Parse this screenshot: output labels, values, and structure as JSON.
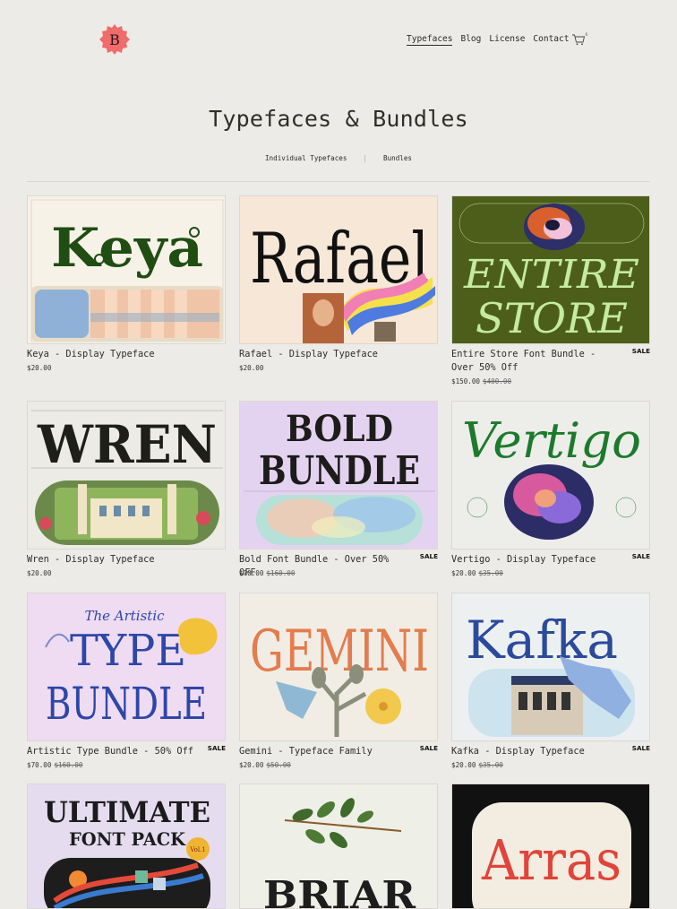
{
  "header": {
    "logo_letter": "B",
    "nav": [
      {
        "label": "Typefaces",
        "active": true
      },
      {
        "label": "Blog"
      },
      {
        "label": "License"
      },
      {
        "label": "Contact"
      }
    ],
    "cart_count": "0"
  },
  "page": {
    "title": "Typefaces & Bundles",
    "filters": [
      "Individual Typefaces",
      "Bundles"
    ]
  },
  "products": [
    {
      "title": "Keya - Display Typeface",
      "price": "$20.00",
      "old_price": "",
      "sale": "",
      "art": "Keya"
    },
    {
      "title": "Rafael - Display Typeface",
      "price": "$20.00",
      "old_price": "",
      "sale": "",
      "art": "Rafael"
    },
    {
      "title": "Entire Store Font Bundle - Over 50% Off",
      "price": "$150.00",
      "old_price": "$400.00",
      "sale": "SALE",
      "art": "ENTIRE STORE"
    },
    {
      "title": "Wren - Display Typeface",
      "price": "$20.00",
      "old_price": "",
      "sale": "",
      "art": "WREN"
    },
    {
      "title": "Bold Font Bundle - Over 50% OFF",
      "price": "$70.00",
      "old_price": "$160.00",
      "sale": "SALE",
      "art": "BOLD BUNDLE"
    },
    {
      "title": "Vertigo - Display Typeface",
      "price": "$20.00",
      "old_price": "$35.00",
      "sale": "SALE",
      "art": "Vertigo"
    },
    {
      "title": "Artistic Type Bundle - 50% Off",
      "price": "$70.00",
      "old_price": "$160.00",
      "sale": "SALE",
      "art": "The Artistic TYPE BUNDLE"
    },
    {
      "title": "Gemini - Typeface Family",
      "price": "$20.00",
      "old_price": "$50.00",
      "sale": "SALE",
      "art": "GEMINI"
    },
    {
      "title": "Kafka - Display Typeface",
      "price": "$20.00",
      "old_price": "$35.00",
      "sale": "SALE",
      "art": "Kafka"
    },
    {
      "title": "",
      "price": "",
      "old_price": "",
      "sale": "",
      "art": "ULTIMATE FONT PACK"
    },
    {
      "title": "",
      "price": "",
      "old_price": "",
      "sale": "",
      "art": "BRIAR"
    },
    {
      "title": "",
      "price": "",
      "old_price": "",
      "sale": "",
      "art": "Arras"
    }
  ],
  "art_extra": {
    "entire_line2": "STORE",
    "bold_line2": "BUNDLE",
    "artistic_line1": "The Artistic",
    "artistic_line2": "TYPE",
    "artistic_line3": "BUNDLE",
    "ultimate_line1": "ULTIMATE",
    "ultimate_line2": "FONT PACK",
    "ultimate_vol": "Vol.1"
  },
  "colors": {
    "background": "#ecebe8",
    "logo": "#f06b6b",
    "keya_green": "#1f4d12",
    "entire_bg": "#4d5e1b",
    "entire_text": "#c4eba0",
    "vertigo_green": "#1d7a2c",
    "artistic_blue": "#2d47a8",
    "gemini_orange": "#e37c4e",
    "kafka_blue": "#2a4a9c",
    "arras_red": "#e0443a"
  }
}
